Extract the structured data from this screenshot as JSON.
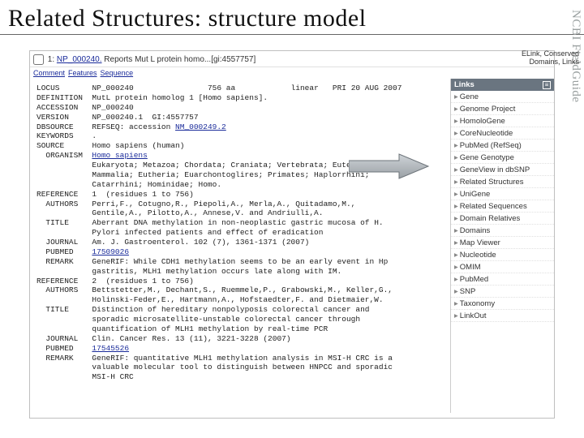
{
  "slide": {
    "title": "Related Structures: structure model",
    "side_label": "NCBI FieldGuide"
  },
  "header": {
    "index": "1:",
    "accession": "NP_000240.",
    "reports": "Reports",
    "summary": "Mut L protein homo...[gi:4557757]",
    "elink_line1": "ELink, Conserved",
    "elink_line2": "Domains, Links"
  },
  "tabs": {
    "comment": "Comment",
    "features": "Features",
    "sequence": "Sequence"
  },
  "record": {
    "locus_lbl": "LOCUS",
    "locus_val": "NP_000240                756 aa            linear   PRI 20 AUG 2007",
    "definition_lbl": "DEFINITION",
    "definition_val": "MutL protein homolog 1 [Homo sapiens].",
    "accession_lbl": "ACCESSION",
    "accession_val": "NP_000240",
    "version_lbl": "VERSION",
    "version_val": "NP_000240.1  GI:4557757",
    "dbsource_lbl": "DBSOURCE",
    "dbsource_pre": "REFSEQ: accession ",
    "dbsource_link": "NM_000249.2",
    "keywords_lbl": "KEYWORDS",
    "keywords_val": ".",
    "source_lbl": "SOURCE",
    "source_val": "Homo sapiens (human)",
    "organism_lbl": "  ORGANISM",
    "organism_link": "Homo sapiens",
    "lineage": "            Eukaryota; Metazoa; Chordata; Craniata; Vertebrata; Euteleostomi;\n            Mammalia; Eutheria; Euarchontoglires; Primates; Haplorrhini;\n            Catarrhini; Hominidae; Homo.",
    "ref1": "REFERENCE   1  (residues 1 to 756)",
    "ref1_auth_lbl": "  AUTHORS",
    "ref1_auth": "Perri,F., Cotugno,R., Piepoli,A., Merla,A., Quitadamo,M.,\n            Gentile,A., Pilotto,A., Annese,V. and Andriulli,A.",
    "ref1_title_lbl": "  TITLE",
    "ref1_title": "Aberrant DNA methylation in non-neoplastic gastric mucosa of H.\n            Pylori infected patients and effect of eradication",
    "ref1_journal_lbl": "  JOURNAL",
    "ref1_journal": "Am. J. Gastroenterol. 102 (7), 1361-1371 (2007)",
    "ref1_pubmed_lbl": "  PUBMED",
    "ref1_pubmed": "17509026",
    "ref1_remark_lbl": "  REMARK",
    "ref1_remark": "GeneRIF: While CDH1 methylation seems to be an early event in Hp\n            gastritis, MLH1 methylation occurs late along with IM.",
    "ref2": "REFERENCE   2  (residues 1 to 756)",
    "ref2_auth_lbl": "  AUTHORS",
    "ref2_auth": "Bettstetter,M., Dechant,S., Ruemmele,P., Grabowski,M., Keller,G.,\n            Holinski-Feder,E., Hartmann,A., Hofstaedter,F. and Dietmaier,W.",
    "ref2_title_lbl": "  TITLE",
    "ref2_title": "Distinction of hereditary nonpolyposis colorectal cancer and\n            sporadic microsatellite-unstable colorectal cancer through\n            quantification of MLH1 methylation by real-time PCR",
    "ref2_journal_lbl": "  JOURNAL",
    "ref2_journal": "Clin. Cancer Res. 13 (11), 3221-3228 (2007)",
    "ref2_pubmed_lbl": "  PUBMED",
    "ref2_pubmed": "17545526",
    "ref2_remark_lbl": "  REMARK",
    "ref2_remark": "GeneRIF: quantitative MLH1 methylation analysis in MSI-H CRC is a\n            valuable molecular tool to distinguish between HNPCC and sporadic\n            MSI-H CRC"
  },
  "sidebar": {
    "title": "Links",
    "items": [
      "Gene",
      "Genome Project",
      "HomoloGene",
      "CoreNucleotide",
      "PubMed (RefSeq)",
      "Gene Genotype",
      "GeneView in dbSNP",
      "Related Structures",
      "UniGene",
      "Related Sequences",
      "Domain Relatives",
      "Domains",
      "Map Viewer",
      "Nucleotide",
      "OMIM",
      "PubMed",
      "SNP",
      "Taxonomy",
      "LinkOut"
    ]
  }
}
